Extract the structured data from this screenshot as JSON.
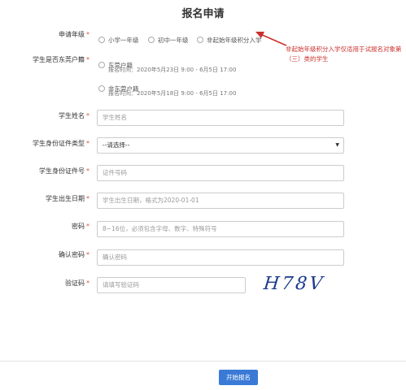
{
  "title": "报名申请",
  "grade": {
    "label": "申请年级",
    "options": [
      "小学一年级",
      "初中一年级",
      "非起始年级积分入学"
    ]
  },
  "hukou": {
    "label": "学生是否东莞户籍",
    "options": [
      {
        "name": "东莞户籍",
        "time": "报名时间：2020年5月23日 9:00 - 6月5日 17:00"
      },
      {
        "name": "非东莞户籍",
        "time": "报名时间：2020年5月18日 9:00 - 6月5日 17:00"
      }
    ]
  },
  "annotation": "非起始年级积分入学仅适用于试报名对象第（三）类的学生",
  "fields": {
    "name": {
      "label": "学生姓名",
      "placeholder": "学生姓名"
    },
    "id_type": {
      "label": "学生身份证件类型",
      "value": "--请选择--"
    },
    "id_number": {
      "label": "学生身份证件号",
      "placeholder": "证件号码"
    },
    "birthday": {
      "label": "学生出生日期",
      "placeholder": "学生出生日期，格式为2020-01-01"
    },
    "password": {
      "label": "密码",
      "placeholder": "8~16位，必须包含字母、数字、特殊符号"
    },
    "confirm": {
      "label": "确认密码",
      "placeholder": "确认密码"
    },
    "captcha": {
      "label": "验证码",
      "placeholder": "请填写验证码",
      "image_text": "H78V"
    }
  },
  "required_mark": "*",
  "submit": "开始报名",
  "colors": {
    "accent": "#3a7ad6",
    "required": "#d9534f",
    "annotation": "#c9302c"
  }
}
